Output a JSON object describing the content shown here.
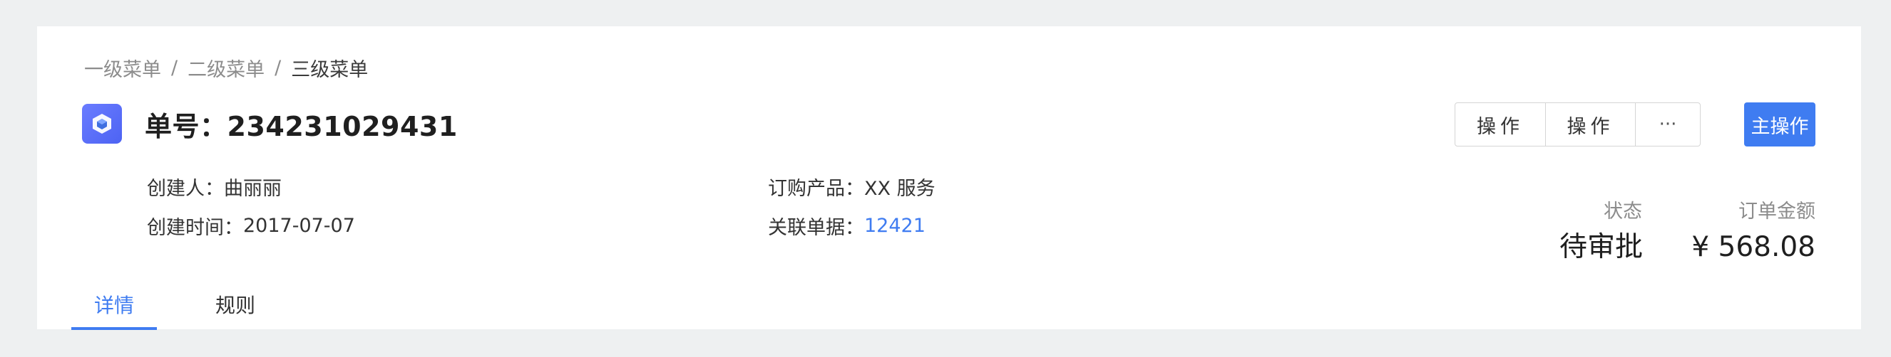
{
  "breadcrumb": {
    "items": [
      "一级菜单",
      "二级菜单",
      "三级菜单"
    ],
    "separator": "/"
  },
  "header": {
    "title": "单号：234231029431",
    "logo_icon": "cube-icon"
  },
  "details": {
    "creator_label": "创建人：",
    "creator_value": "曲丽丽",
    "created_time_label": "创建时间：",
    "created_time_value": "2017-07-07",
    "product_label": "订购产品：",
    "product_value": "XX 服务",
    "related_label": "关联单据：",
    "related_value": "12421"
  },
  "actions": {
    "op1": "操作",
    "op2": "操作",
    "more": "···",
    "primary": "主操作"
  },
  "stats": {
    "status_label": "状态",
    "status_value": "待审批",
    "amount_label": "订单金额",
    "amount_value": "¥ 568.08"
  },
  "tabs": [
    {
      "label": "详情",
      "active": true
    },
    {
      "label": "规则",
      "active": false
    }
  ],
  "colors": {
    "accent": "#3f7cf1",
    "background": "#eef0f1",
    "card": "#ffffff",
    "logo": "#5569f5"
  }
}
